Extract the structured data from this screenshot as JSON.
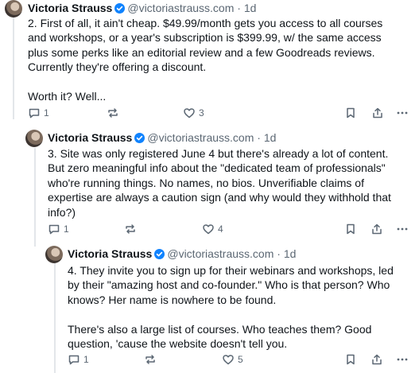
{
  "posts": [
    {
      "author": "Victoria Strauss",
      "handle": "@victoriastrauss.com",
      "sep": "·",
      "time": "1d",
      "paragraphs": [
        "2. First of all, it ain't cheap. $49.99/month gets you access to all courses and workshops, or a year's subscription is $399.99, w/ the same access plus some perks like an editorial review and a few Goodreads reviews. Currently they're offering a discount.",
        "Worth it? Well..."
      ],
      "replies": "1",
      "reposts": "",
      "likes": "3"
    },
    {
      "author": "Victoria Strauss",
      "handle": "@victoriastrauss.com",
      "sep": "·",
      "time": "1d",
      "paragraphs": [
        "3. Site was only registered June 4 but there's already a lot of content. But zero meaningful info about the \"dedicated team of professionals\" who're running things. No names, no bios. Unverifiable claims of expertise are always a caution sign (and why would they withhold that info?)"
      ],
      "replies": "1",
      "reposts": "",
      "likes": "4"
    },
    {
      "author": "Victoria Strauss",
      "handle": "@victoriastrauss.com",
      "sep": "·",
      "time": "1d",
      "paragraphs": [
        "4. They invite you to sign up for their webinars and workshops, led by their \"amazing host and co-founder.\" Who is that person? Who knows? Her name is nowhere to be found.",
        "There's also a large list of courses. Who teaches them? Good question, 'cause the website doesn't tell you."
      ],
      "replies": "1",
      "reposts": "",
      "likes": "5"
    }
  ],
  "colors": {
    "verified": "#1083fe",
    "muted": "#5b6773",
    "text": "#0f1419",
    "thread": "#e3e6ea"
  },
  "icons": [
    "verified-badge-icon",
    "reply-icon",
    "repost-icon",
    "like-icon",
    "bookmark-icon",
    "share-icon",
    "more-icon"
  ]
}
